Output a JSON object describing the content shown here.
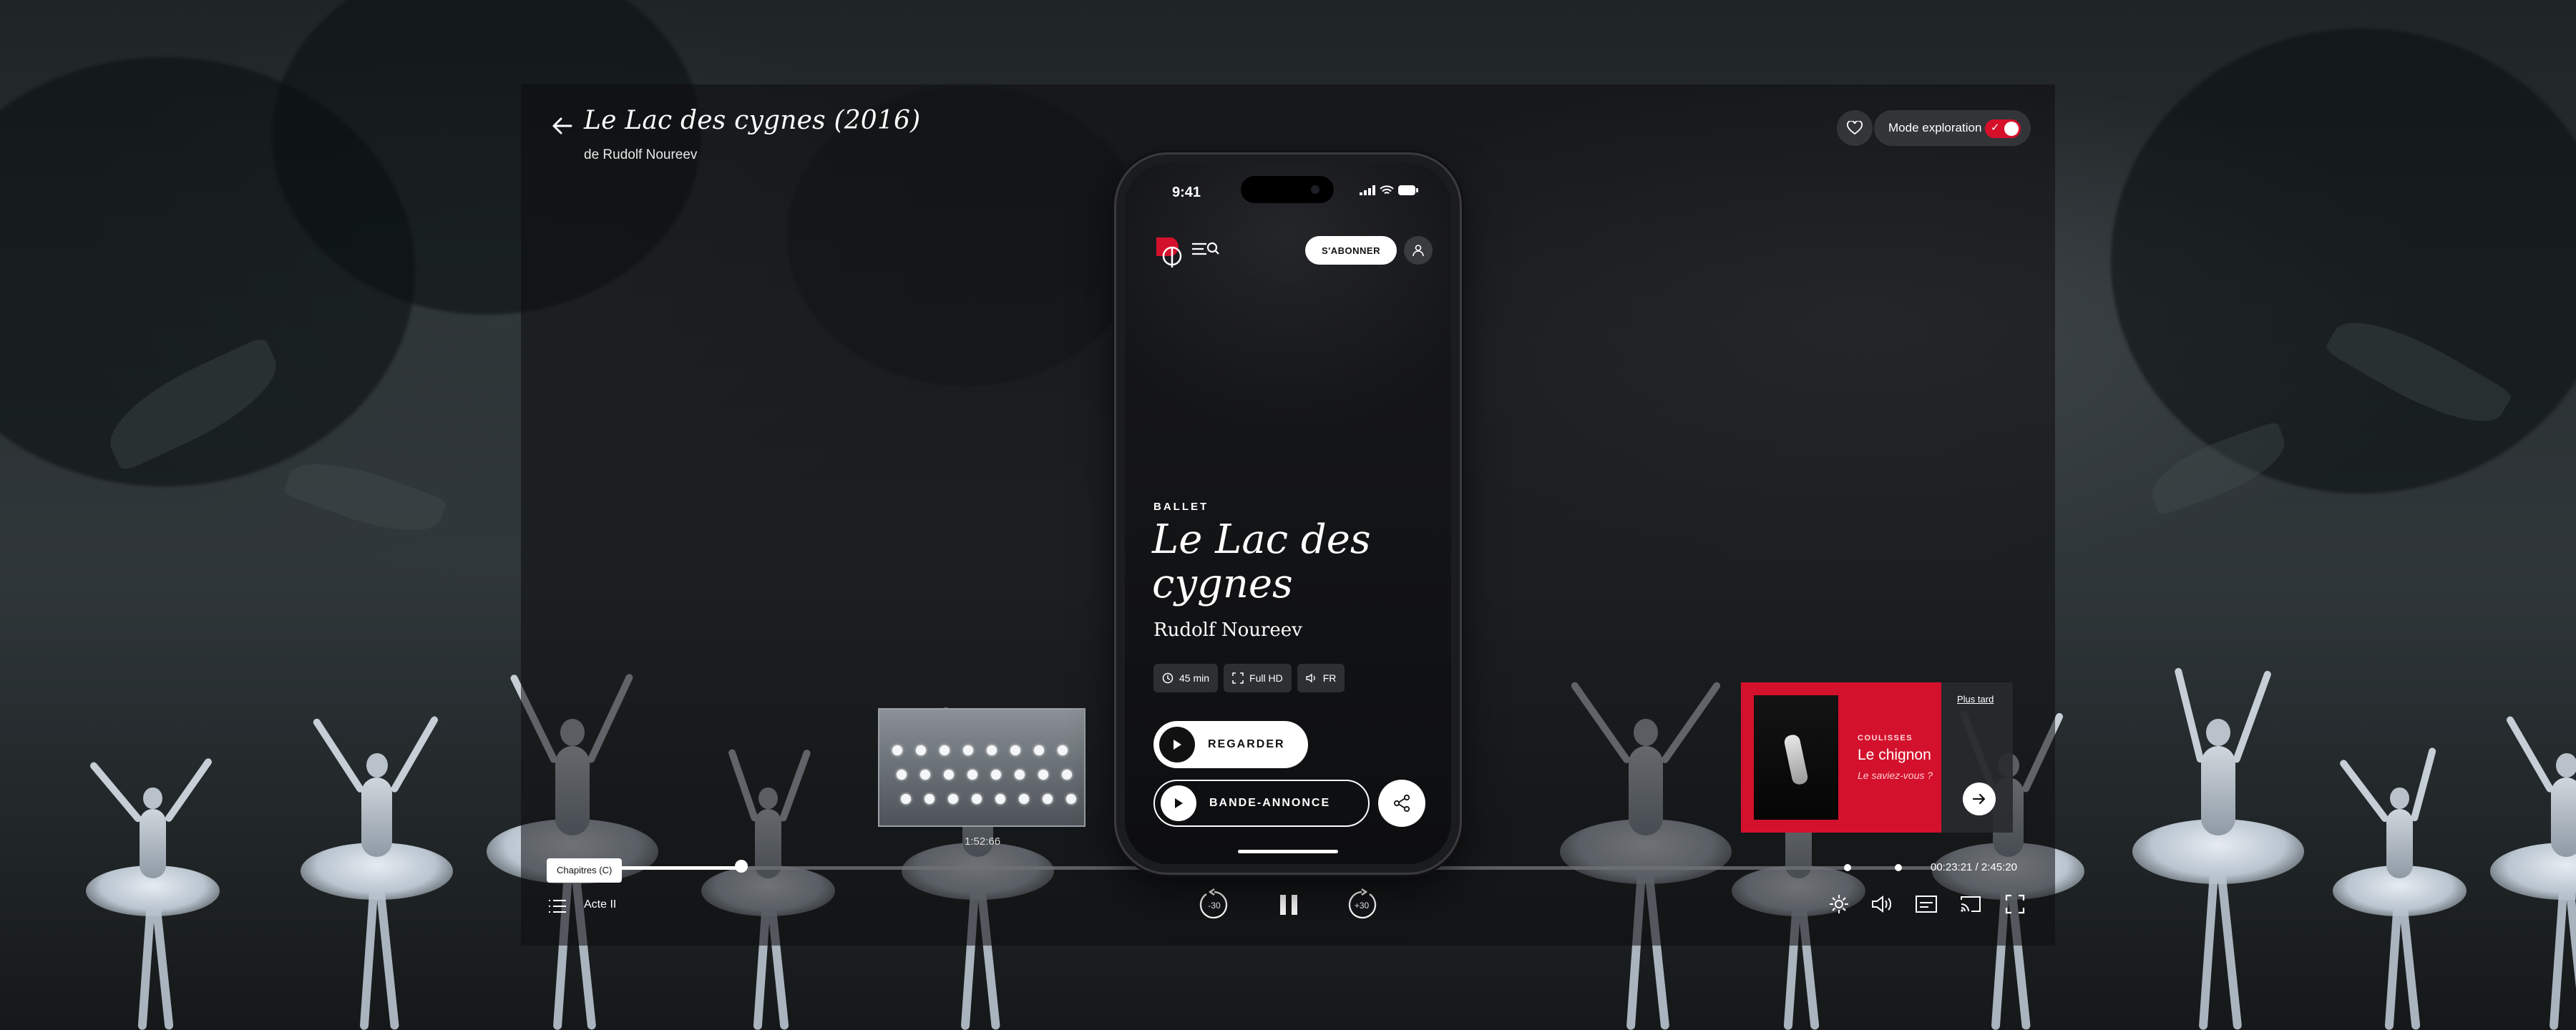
{
  "header": {
    "title": "Le Lac des cygnes (2016)",
    "subtitle": "de Rudolf Noureev",
    "mode_label": "Mode exploration",
    "mode_enabled": true
  },
  "preview": {
    "time": "1:52:66"
  },
  "recommendation": {
    "kicker": "COULISSES",
    "title": "Le chignon",
    "subtitle": "Le saviez-vous ?",
    "later_label": "Plus tard"
  },
  "player": {
    "chapter_tooltip": "Chapitres (C)",
    "chapter_current": "Acte II",
    "time_readout": "00:23:21 / 2:45:20",
    "progress": 0.14,
    "rewind_label": "-30",
    "forward_label": "+30"
  },
  "phone": {
    "status_time": "9:41",
    "subscribe_label": "S'ABONNER",
    "genre": "BALLET",
    "title": "Le Lac des cygnes",
    "author": "Rudolf Noureev",
    "chips": [
      {
        "icon": "clock-icon",
        "label": "45 min"
      },
      {
        "icon": "expand-icon",
        "label": "Full HD"
      },
      {
        "icon": "speaker-icon",
        "label": "FR"
      }
    ],
    "watch_label": "REGARDER",
    "trailer_label": "BANDE-ANNONCE"
  },
  "colors": {
    "accent": "#d4112c",
    "background": "#0b0c0d"
  }
}
